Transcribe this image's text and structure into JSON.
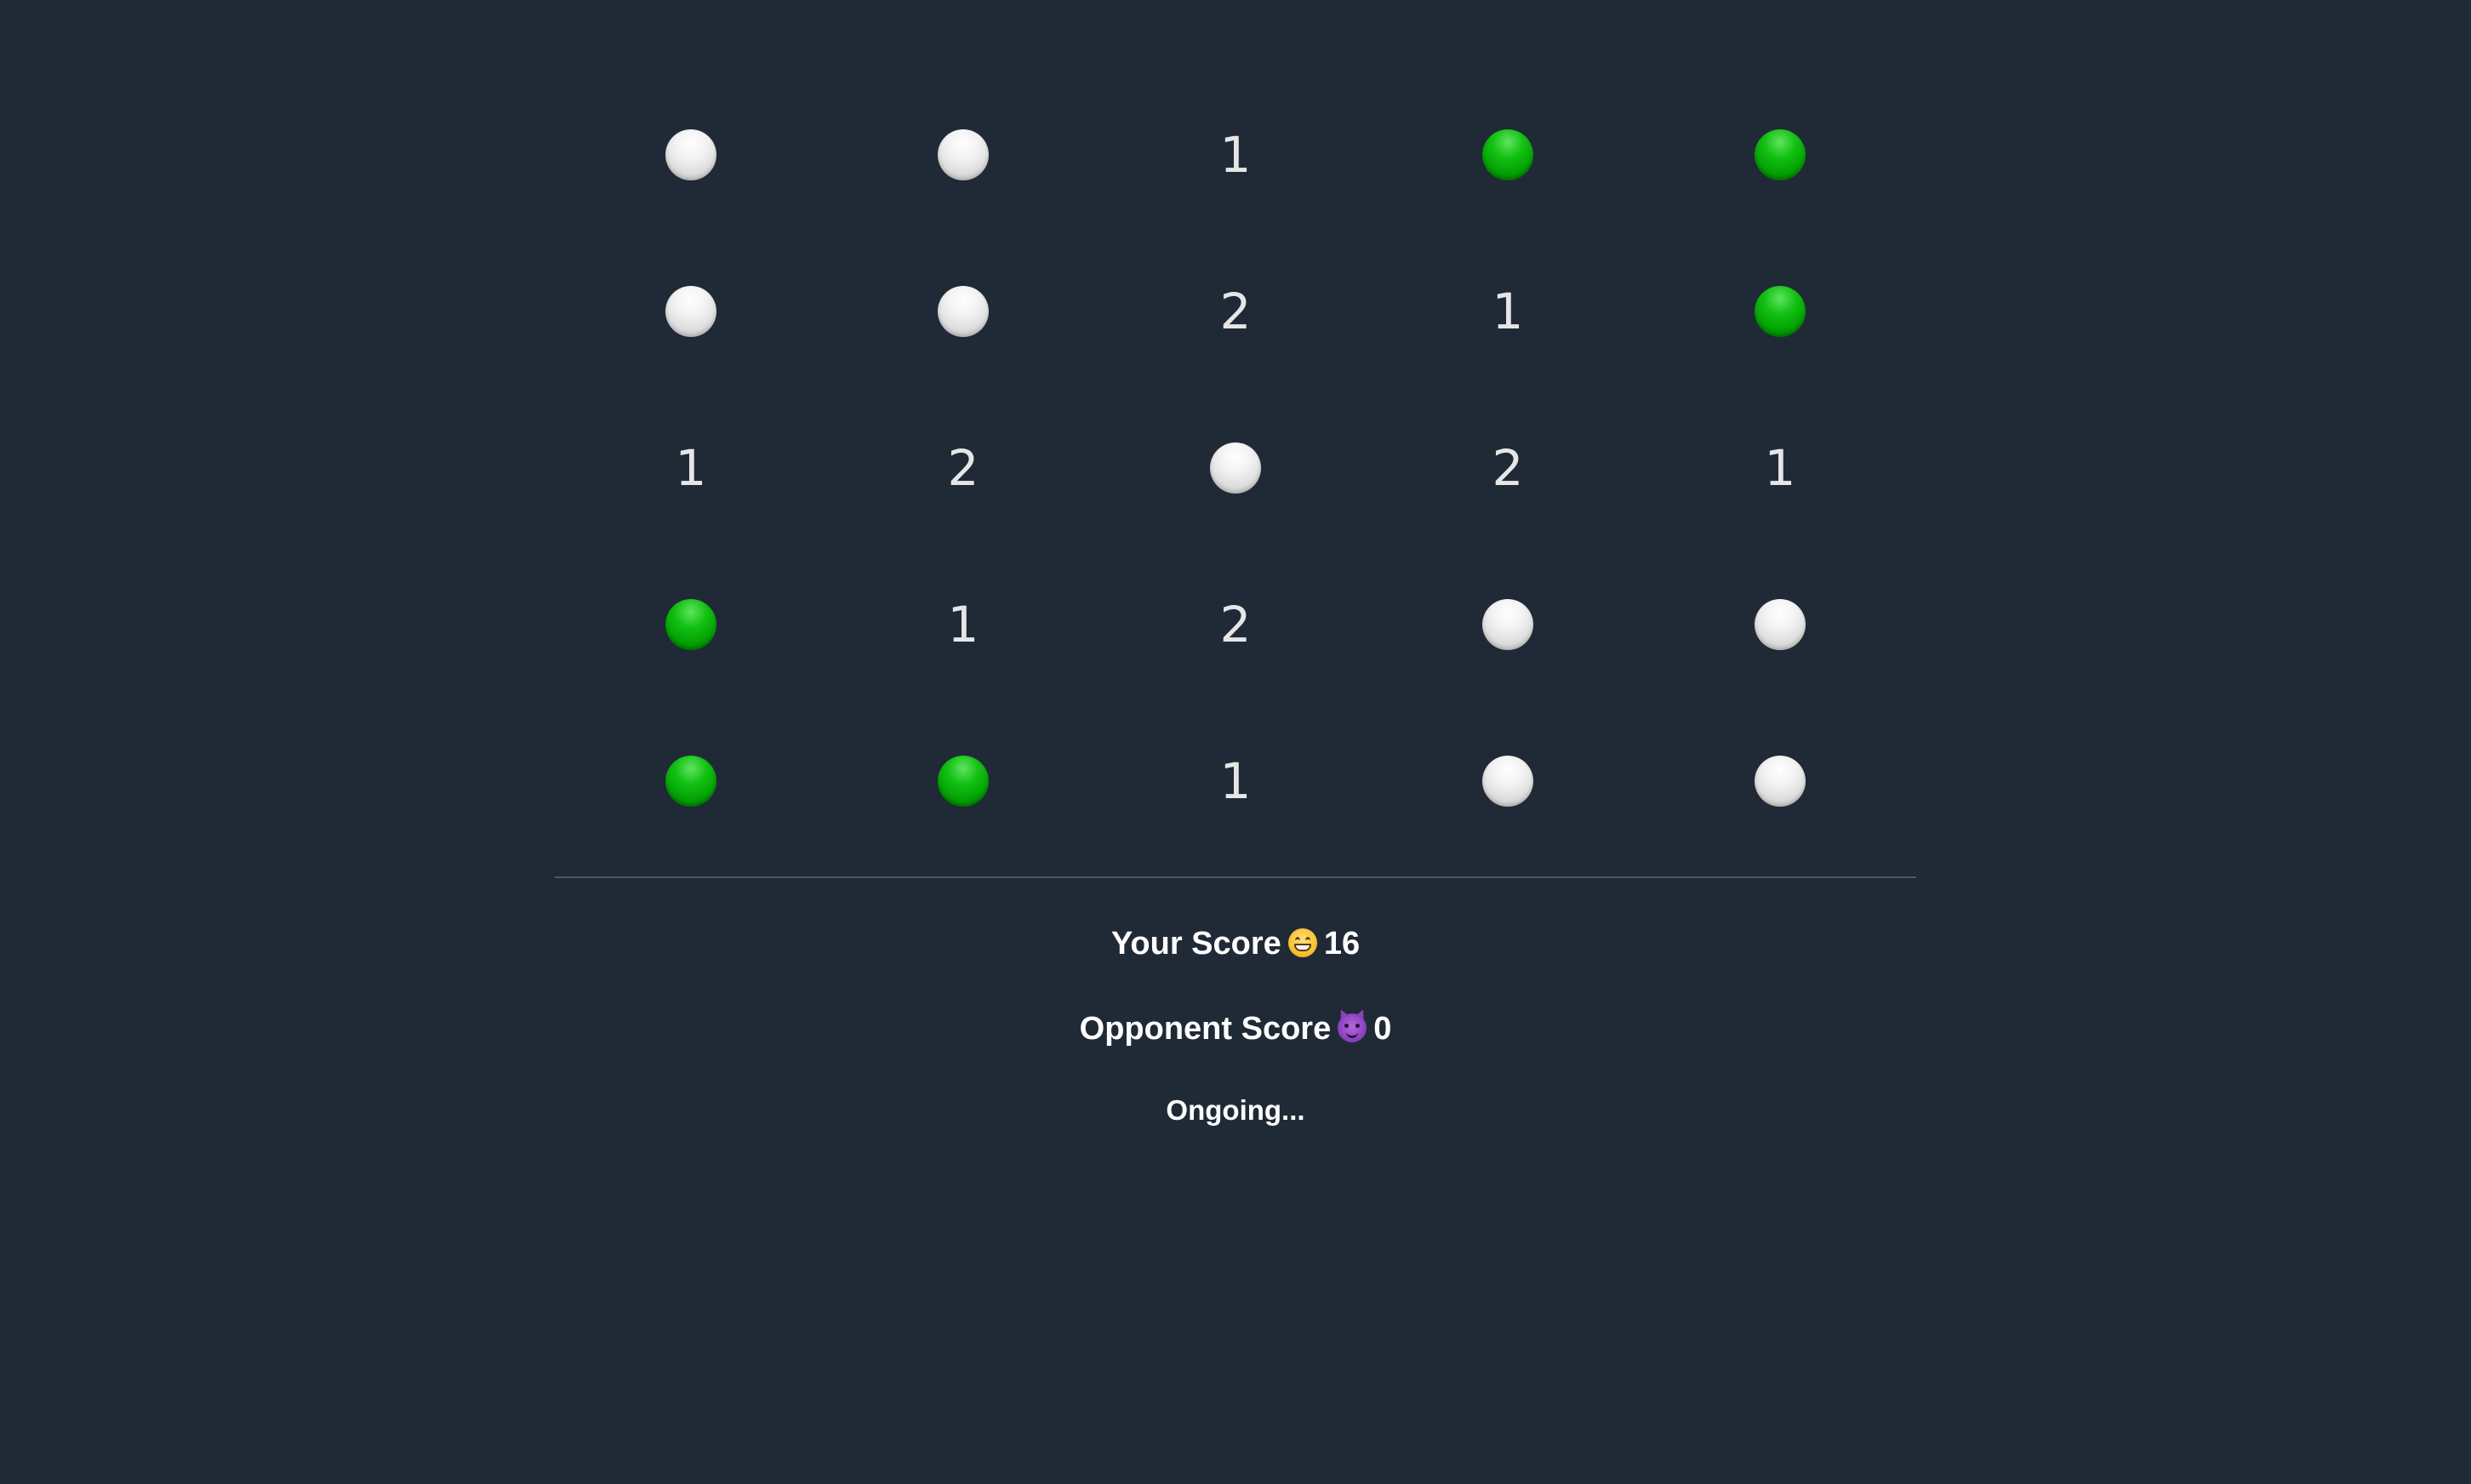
{
  "board": {
    "rows": [
      [
        {
          "type": "ball",
          "color": "white"
        },
        {
          "type": "ball",
          "color": "white"
        },
        {
          "type": "number",
          "value": "1"
        },
        {
          "type": "ball",
          "color": "green"
        },
        {
          "type": "ball",
          "color": "green"
        }
      ],
      [
        {
          "type": "ball",
          "color": "white"
        },
        {
          "type": "ball",
          "color": "white"
        },
        {
          "type": "number",
          "value": "2"
        },
        {
          "type": "number",
          "value": "1"
        },
        {
          "type": "ball",
          "color": "green"
        }
      ],
      [
        {
          "type": "number",
          "value": "1"
        },
        {
          "type": "number",
          "value": "2"
        },
        {
          "type": "ball",
          "color": "white"
        },
        {
          "type": "number",
          "value": "2"
        },
        {
          "type": "number",
          "value": "1"
        }
      ],
      [
        {
          "type": "ball",
          "color": "green"
        },
        {
          "type": "number",
          "value": "1"
        },
        {
          "type": "number",
          "value": "2"
        },
        {
          "type": "ball",
          "color": "white"
        },
        {
          "type": "ball",
          "color": "white"
        }
      ],
      [
        {
          "type": "ball",
          "color": "green"
        },
        {
          "type": "ball",
          "color": "green"
        },
        {
          "type": "number",
          "value": "1"
        },
        {
          "type": "ball",
          "color": "white"
        },
        {
          "type": "ball",
          "color": "white"
        }
      ]
    ]
  },
  "scores": {
    "your_label": "Your Score",
    "your_icon": "grinning-face-icon",
    "your_value": "16",
    "opponent_label": "Opponent Score",
    "opponent_icon": "devil-face-icon",
    "opponent_value": "0"
  },
  "status": "Ongoing...",
  "colors": {
    "background": "#202a37",
    "ball_green": "#12c012",
    "ball_white": "#f2f2f2",
    "number_text": "#e6e6e6"
  }
}
